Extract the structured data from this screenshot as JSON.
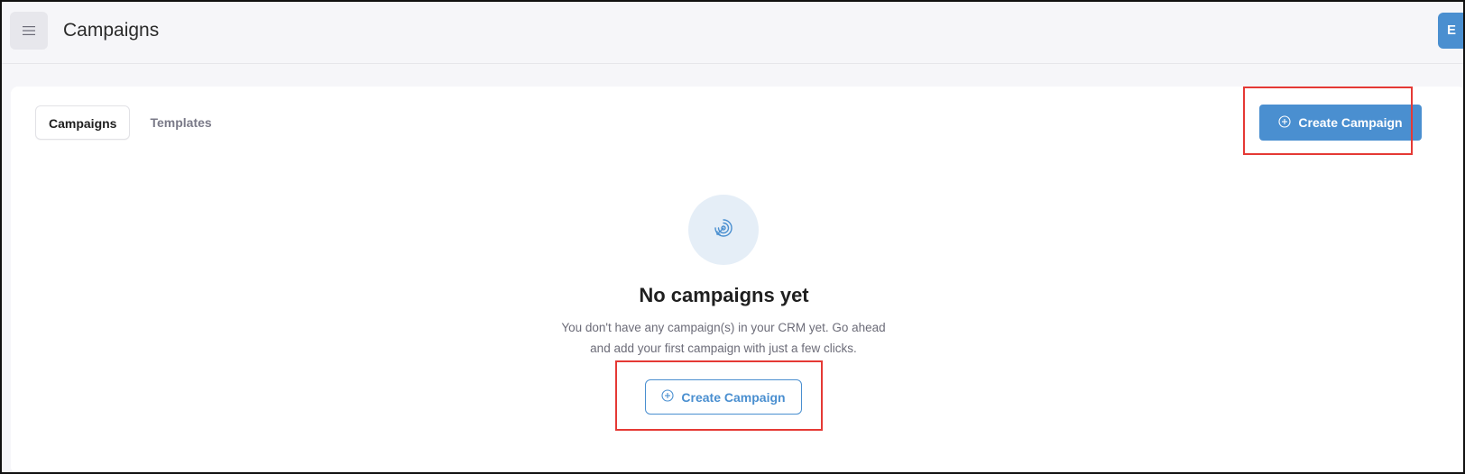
{
  "header": {
    "menu_icon": "hamburger-menu-icon",
    "title": "Campaigns",
    "avatar_initial": "E"
  },
  "tabs": [
    {
      "label": "Campaigns",
      "active": true
    },
    {
      "label": "Templates",
      "active": false
    }
  ],
  "toolbar": {
    "create_label": "Create Campaign",
    "create_icon": "plus-circle-icon"
  },
  "empty_state": {
    "icon": "target-icon",
    "title": "No campaigns yet",
    "description": "You don't have any campaign(s) in your CRM yet. Go ahead and add your first campaign with just a few clicks.",
    "button_label": "Create Campaign",
    "button_icon": "plus-circle-icon"
  },
  "colors": {
    "accent": "#4a8fd0",
    "highlight": "#e53935",
    "page_bg": "#f6f6f9",
    "icon_bg": "#e5eef7"
  }
}
